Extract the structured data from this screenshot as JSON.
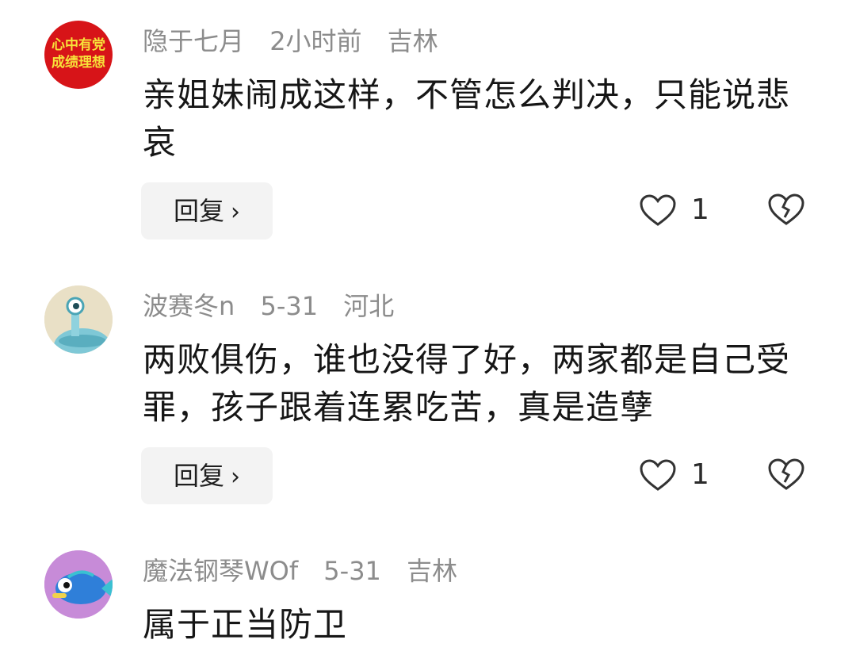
{
  "comments": [
    {
      "avatar_text_line1": "心中有党",
      "avatar_text_line2": "成绩理想",
      "username": "隐于七月",
      "time": "2小时前",
      "location": "吉林",
      "text": "亲姐妹闹成这样，不管怎么判决，只能说悲哀",
      "reply_label": "回复",
      "like_count": "1",
      "avatar_color": "#d71418"
    },
    {
      "username": "波赛冬n",
      "time": "5-31",
      "location": "河北",
      "text": "两败俱伤，谁也没得了好，两家都是自己受罪，孩子跟着连累吃苦，真是造孽",
      "reply_label": "回复",
      "like_count": "1",
      "avatar_color": "#e9e0c6"
    },
    {
      "username": "魔法钢琴WOf",
      "time": "5-31",
      "location": "吉林",
      "text": "属于正当防卫",
      "avatar_color": "#c78bd8"
    }
  ],
  "icons": {
    "like": "heart-outline-icon",
    "dislike": "broken-heart-icon",
    "reply_chevron": "chevron-right-icon"
  }
}
